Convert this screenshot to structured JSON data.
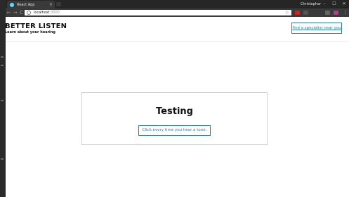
{
  "browser": {
    "tab_title": "React App",
    "tab_close": "×",
    "user_name": "Christopher",
    "window_controls": {
      "minimize": "–",
      "maximize": "☐",
      "close": "✕"
    },
    "nav": {
      "back": "←",
      "forward": "→",
      "reload": "C"
    },
    "address": {
      "host": "localhost",
      "port": ":3000"
    },
    "star": "☆",
    "menu": "⋮",
    "extension_colors": [
      "#c62828",
      "#555555",
      "#666666",
      "#b23a8c"
    ],
    "favicon_color": "#61dafb"
  },
  "header": {
    "title": "BETTER LISTEN",
    "subtitle": "Learn about your hearing",
    "find_button": "find a specialist near you"
  },
  "main": {
    "heading": "Testing",
    "tone_button": "Click every time you hear a tone."
  },
  "colors": {
    "accent": "#2e7ea3",
    "browser_chrome": "#3a3a3a",
    "titlebar": "#262626"
  }
}
